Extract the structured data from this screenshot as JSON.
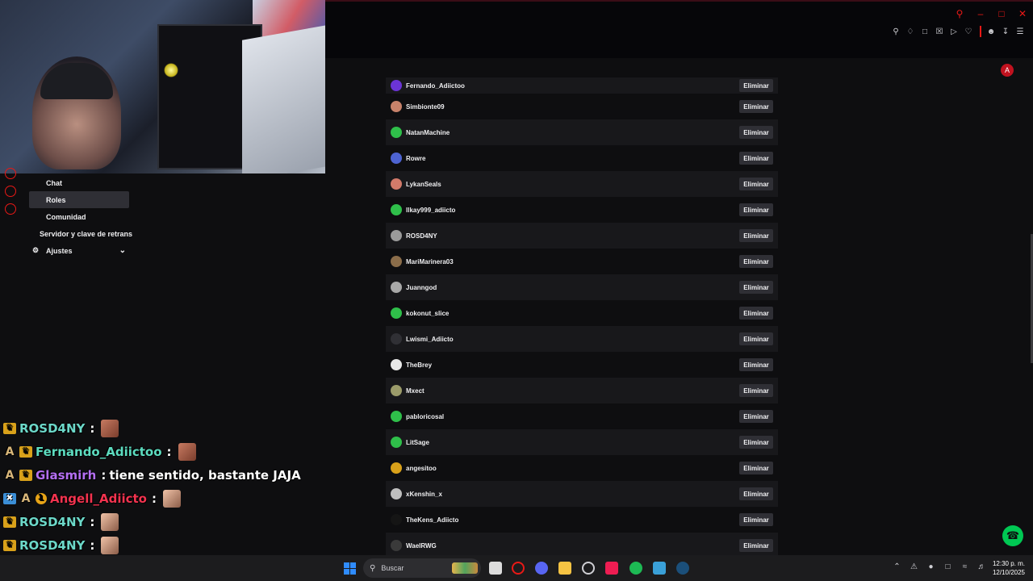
{
  "nav": {
    "items": [
      {
        "label": "Chat"
      },
      {
        "label": "Roles"
      },
      {
        "label": "Comunidad"
      },
      {
        "label": "Servidor y clave de retrans"
      },
      {
        "label": "Ajustes"
      }
    ]
  },
  "roles_list": {
    "button_label": "Eliminar",
    "users": [
      {
        "name": "Fernando_Adiictoo",
        "avatar_color": "#6b34d6"
      },
      {
        "name": "Simbionte09",
        "avatar_color": "#c7826a"
      },
      {
        "name": "NatanMachine",
        "avatar_color": "#2fbf4a"
      },
      {
        "name": "Rowre",
        "avatar_color": "#4d63d1"
      },
      {
        "name": "LykanSeals",
        "avatar_color": "#d27a6a"
      },
      {
        "name": "llkay999_adiicto",
        "avatar_color": "#2fbf4a"
      },
      {
        "name": "ROSD4NY",
        "avatar_color": "#9a9a9a"
      },
      {
        "name": "MariMarinera03",
        "avatar_color": "#8b6d4a"
      },
      {
        "name": "Juanngod",
        "avatar_color": "#a8a8a8"
      },
      {
        "name": "kokonut_slice",
        "avatar_color": "#2fbf4a"
      },
      {
        "name": "Lwismi_Adiicto",
        "avatar_color": "#303035"
      },
      {
        "name": "TheBrey",
        "avatar_color": "#e8e8e8"
      },
      {
        "name": "Mxect",
        "avatar_color": "#9b9b6a"
      },
      {
        "name": "pabloricosal",
        "avatar_color": "#2fbf4a"
      },
      {
        "name": "LitSage",
        "avatar_color": "#2fbf4a"
      },
      {
        "name": "angesitoo",
        "avatar_color": "#d9a11a"
      },
      {
        "name": "xKenshin_x",
        "avatar_color": "#bfbfbf"
      },
      {
        "name": "TheKens_Adiicto",
        "avatar_color": "#151515"
      },
      {
        "name": "WaelRWG",
        "avatar_color": "#3a3a3a"
      }
    ]
  },
  "chat": {
    "messages": [
      {
        "badges": [
          "crown"
        ],
        "user": "ROSD4NY",
        "user_color": "#6cd8c9",
        "text": "",
        "emote": "face-red"
      },
      {
        "badges": [
          "a",
          "crown"
        ],
        "user": "Fernando_Adiictoo",
        "user_color": "#5ddcc0",
        "text": "",
        "emote": "face-red"
      },
      {
        "badges": [
          "a",
          "crown"
        ],
        "user": "Glasmirh",
        "user_color": "#b46ff2",
        "text": "tiene sentido, bastante JAJA",
        "emote": ""
      },
      {
        "badges": [
          "x",
          "a",
          "one"
        ],
        "user": "Angell_Adiicto",
        "user_color": "#f2334f",
        "text": "",
        "emote": "face"
      },
      {
        "badges": [
          "crown"
        ],
        "user": "ROSD4NY",
        "user_color": "#6cd8c9",
        "text": "",
        "emote": "face"
      },
      {
        "badges": [
          "crown"
        ],
        "user": "ROSD4NY",
        "user_color": "#6cd8c9",
        "text": "",
        "emote": "face"
      },
      {
        "badges": [
          "crown"
        ],
        "user": "ROSD4NY",
        "user_color": "#6cd8c9",
        "text": "",
        "emote": "face"
      }
    ]
  },
  "profile": {
    "initial": "A"
  },
  "taskbar": {
    "search_placeholder": "Buscar",
    "time": "12:30 p. m.",
    "date": "12/10/2025"
  },
  "colors": {
    "accent": "#e91916",
    "support": "#00c853"
  }
}
